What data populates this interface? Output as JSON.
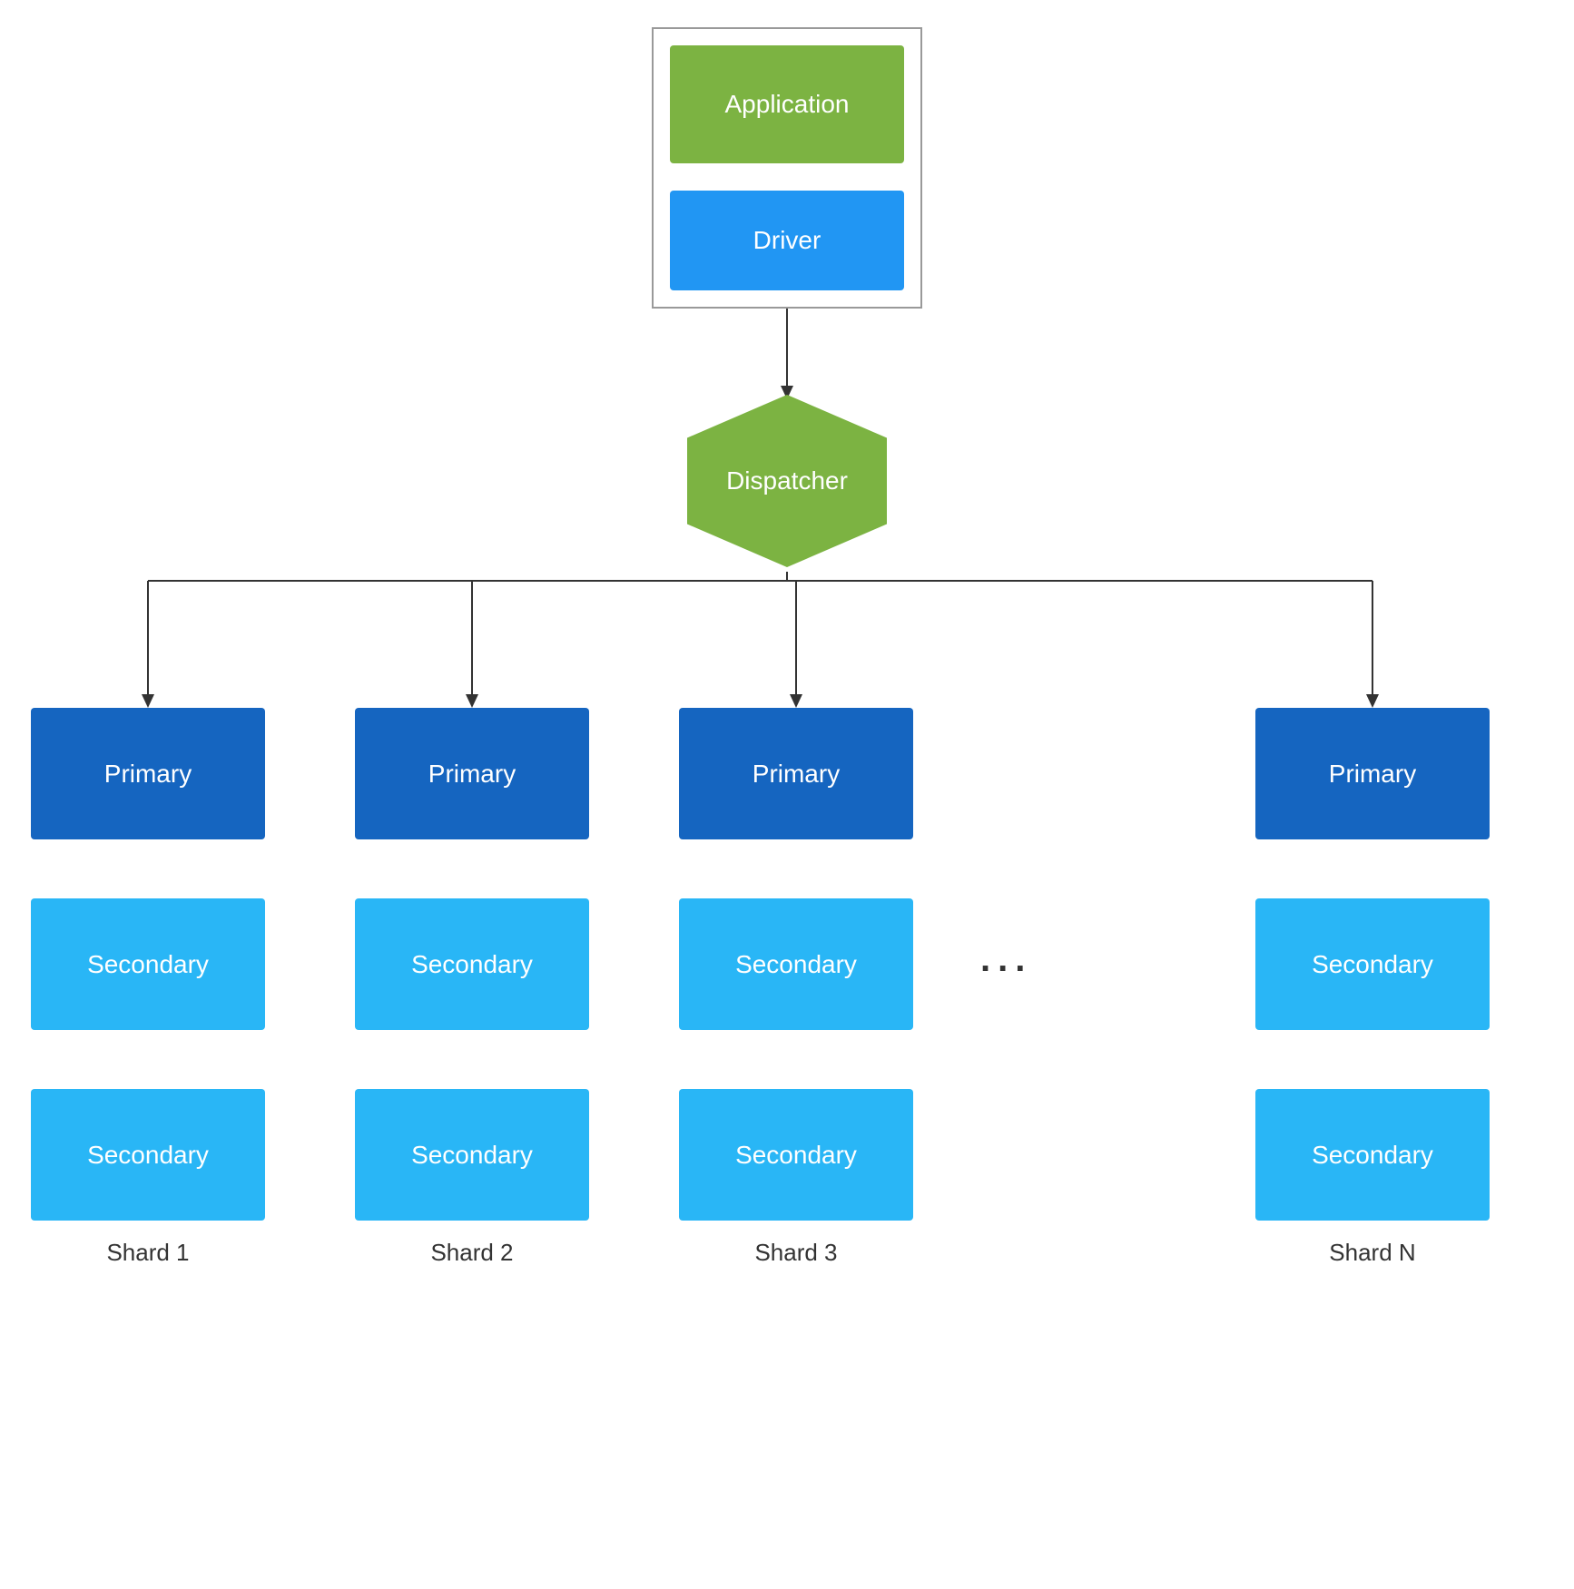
{
  "nodes": {
    "application": {
      "label": "Application"
    },
    "driver": {
      "label": "Driver"
    },
    "dispatcher": {
      "label": "Dispatcher"
    },
    "primaries": [
      "Primary",
      "Primary",
      "Primary",
      "Primary"
    ],
    "secondary_row1": [
      "Secondary",
      "Secondary",
      "Secondary",
      "Secondary"
    ],
    "secondary_row2": [
      "Secondary",
      "Secondary",
      "Secondary",
      "Secondary"
    ],
    "shards": [
      "Shard 1",
      "Shard 2",
      "Shard 3",
      "Shard N"
    ],
    "dots": "...",
    "colors": {
      "green": "#7cb342",
      "blue_dark": "#1565c0",
      "blue_mid": "#1e88e5",
      "blue_light": "#29b6f6",
      "border": "#888888"
    }
  }
}
